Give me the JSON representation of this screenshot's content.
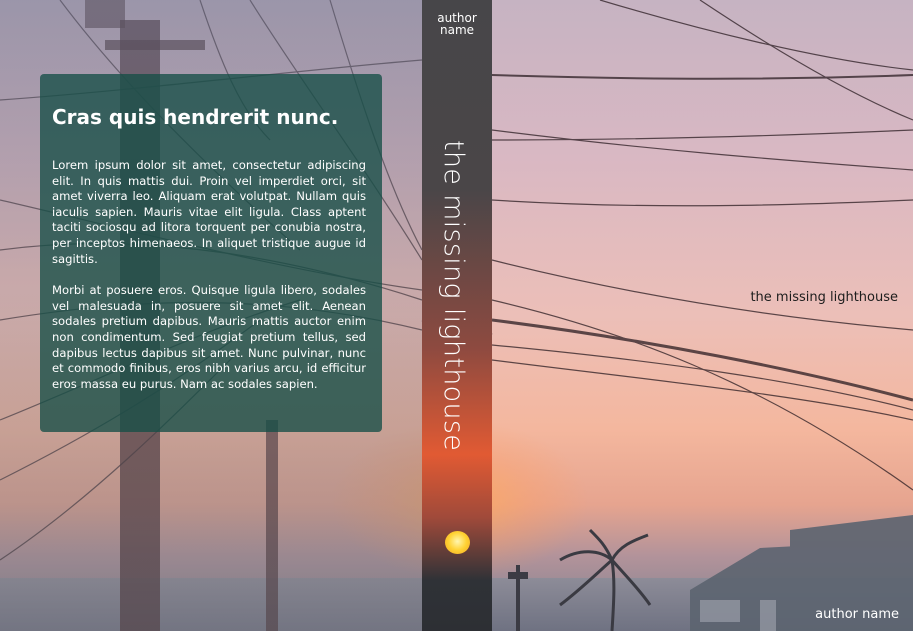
{
  "back_cover": {
    "heading": "Cras quis hendrerit nunc.",
    "paragraphs": [
      "Lorem ipsum dolor sit amet, consectetur adipiscing elit. In quis mattis dui. Proin vel imperdiet orci, sit amet viverra leo. Aliquam erat volutpat. Nullam quis iaculis sapien. Mauris vitae elit ligula. Class aptent taciti sociosqu ad litora torquent per conubia nostra, per inceptos himenaeos. In aliquet tristique augue id sagittis.",
      "Morbi at posuere eros. Quisque ligula libero, sodales vel malesuada in, posuere sit amet elit. Aenean sodales pretium dapibus. Mauris mattis auctor enim non condimentum. Sed feugiat pretium tellus, sed dapibus lectus dapibus sit amet. Nunc pulvinar, nunc et commodo finibus, eros nibh varius arcu, id efficitur eros massa eu purus. Nam ac sodales sapien."
    ]
  },
  "spine": {
    "author_line1": "author",
    "author_line2": "name",
    "title": "the missing lighthouse"
  },
  "front_cover": {
    "title": "the missing lighthouse",
    "author": "author name"
  },
  "colors": {
    "panel": "#164e46",
    "spine_accent": "#e15a33",
    "sun": "#ffd233"
  }
}
